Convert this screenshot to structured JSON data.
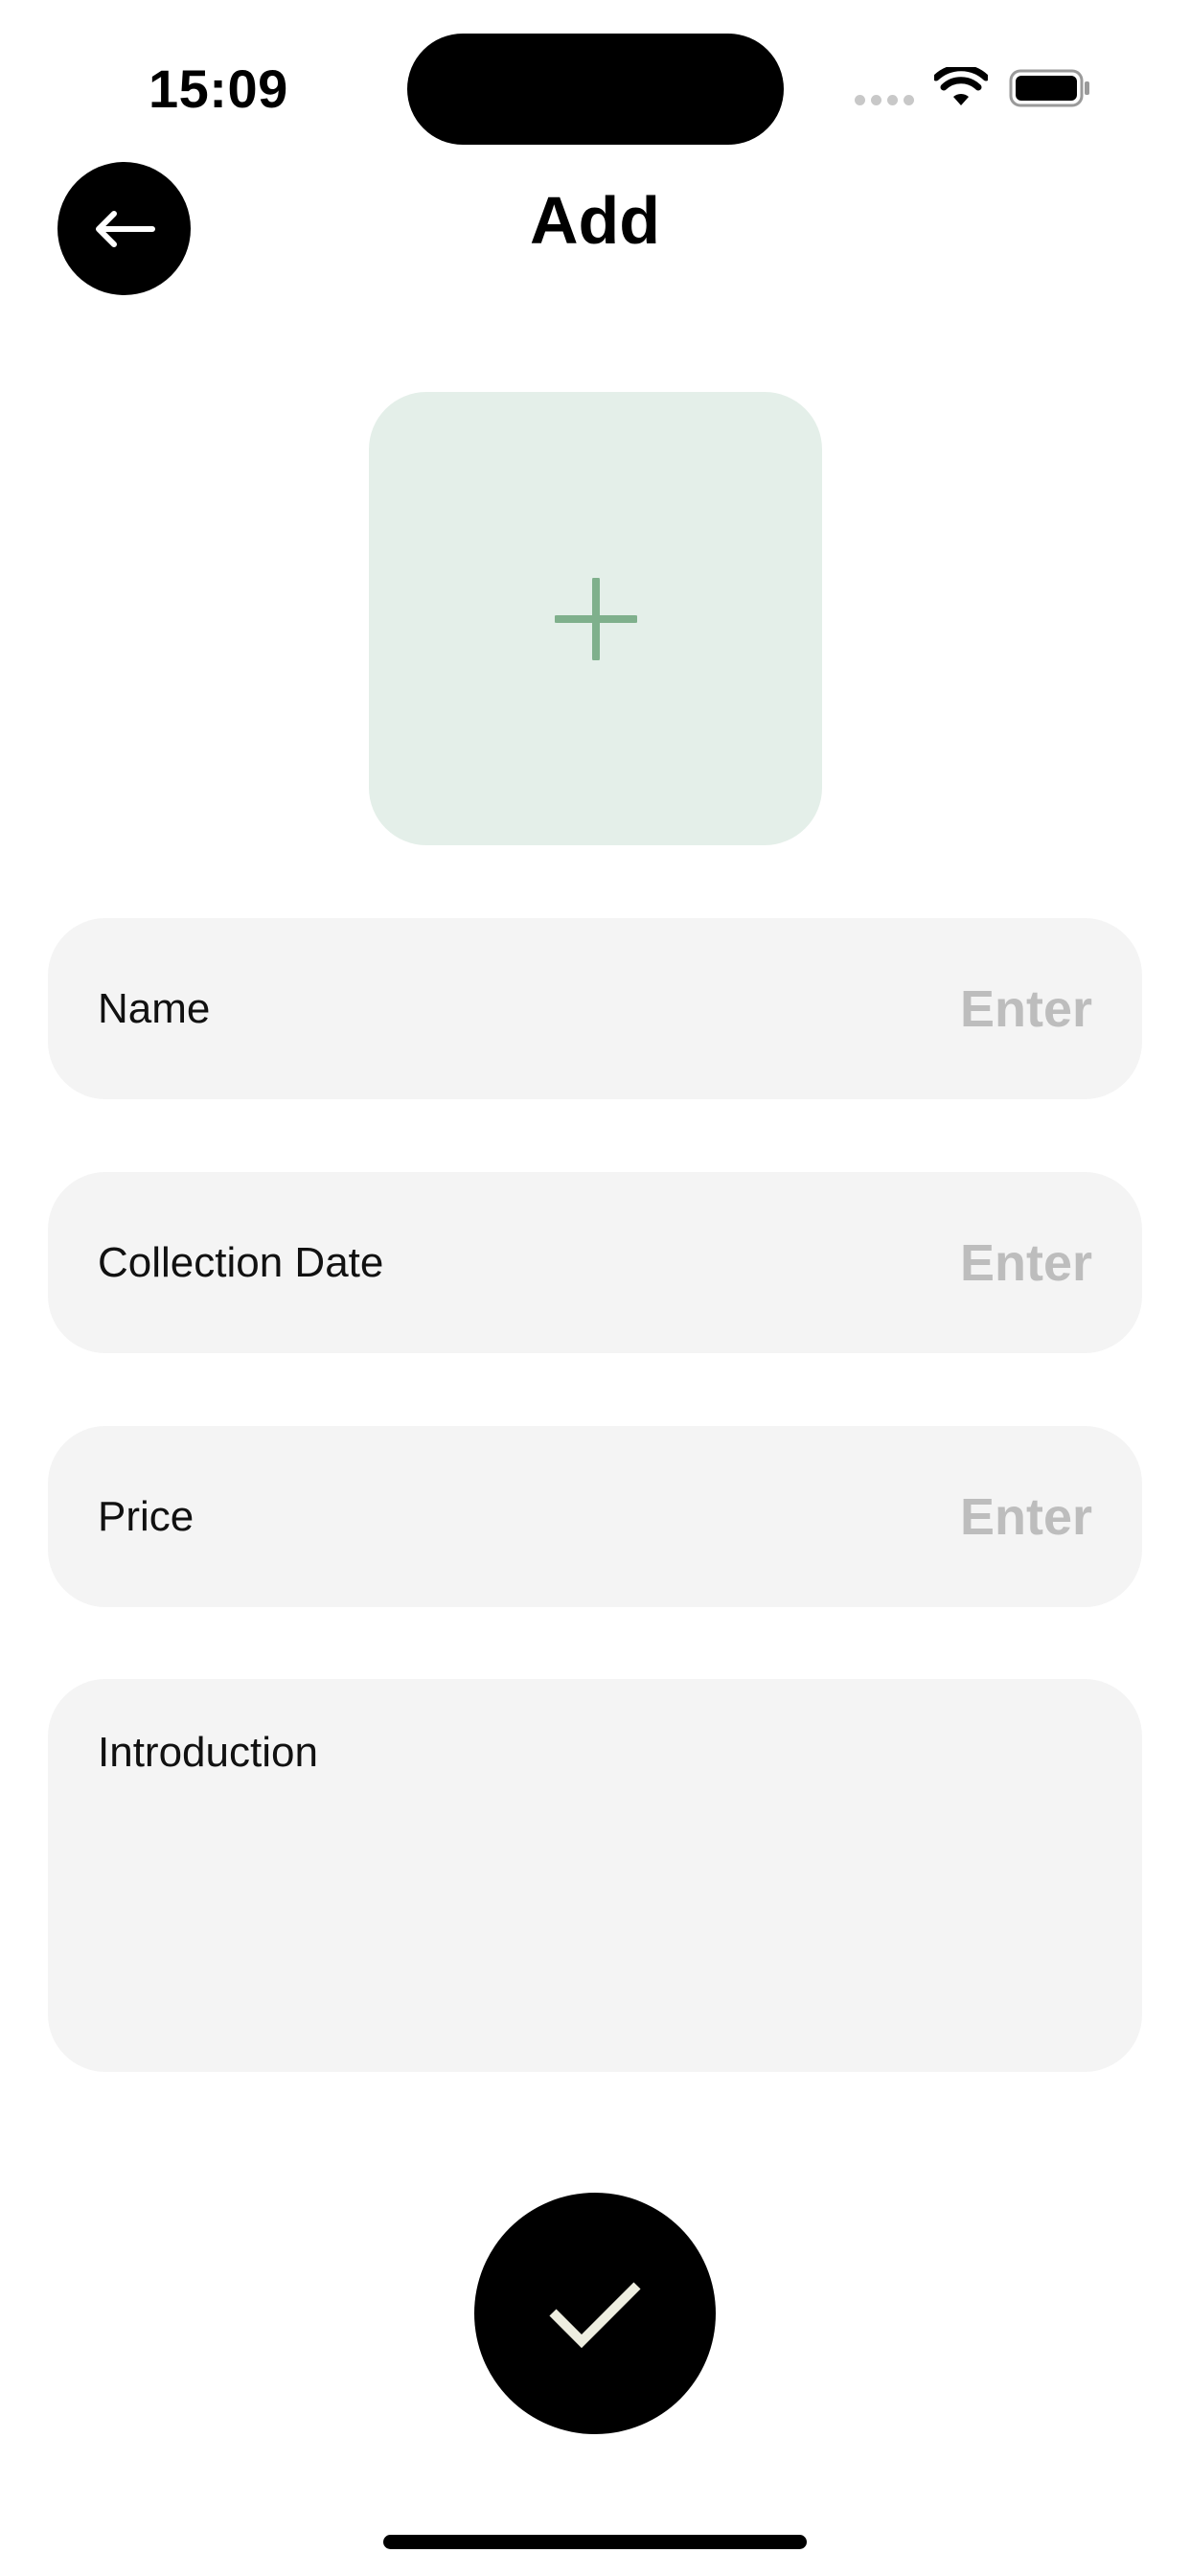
{
  "status_bar": {
    "time": "15:09"
  },
  "header": {
    "title": "Add",
    "back_icon": "arrow-left-icon"
  },
  "photo": {
    "icon": "plus-icon"
  },
  "form": {
    "name": {
      "label": "Name",
      "placeholder": "Enter",
      "value": ""
    },
    "collection_date": {
      "label": "Collection Date",
      "placeholder": "Enter",
      "value": ""
    },
    "price": {
      "label": "Price",
      "placeholder": "Enter",
      "value": ""
    },
    "introduction": {
      "label": "Introduction",
      "value": ""
    }
  },
  "confirm": {
    "icon": "checkmark-icon"
  },
  "colors": {
    "accent_green": "#7fb08c",
    "tile_bg": "#e4efe9",
    "field_bg": "#f4f4f4",
    "placeholder": "#bdbdbd",
    "check_stroke": "#eeeee0"
  }
}
